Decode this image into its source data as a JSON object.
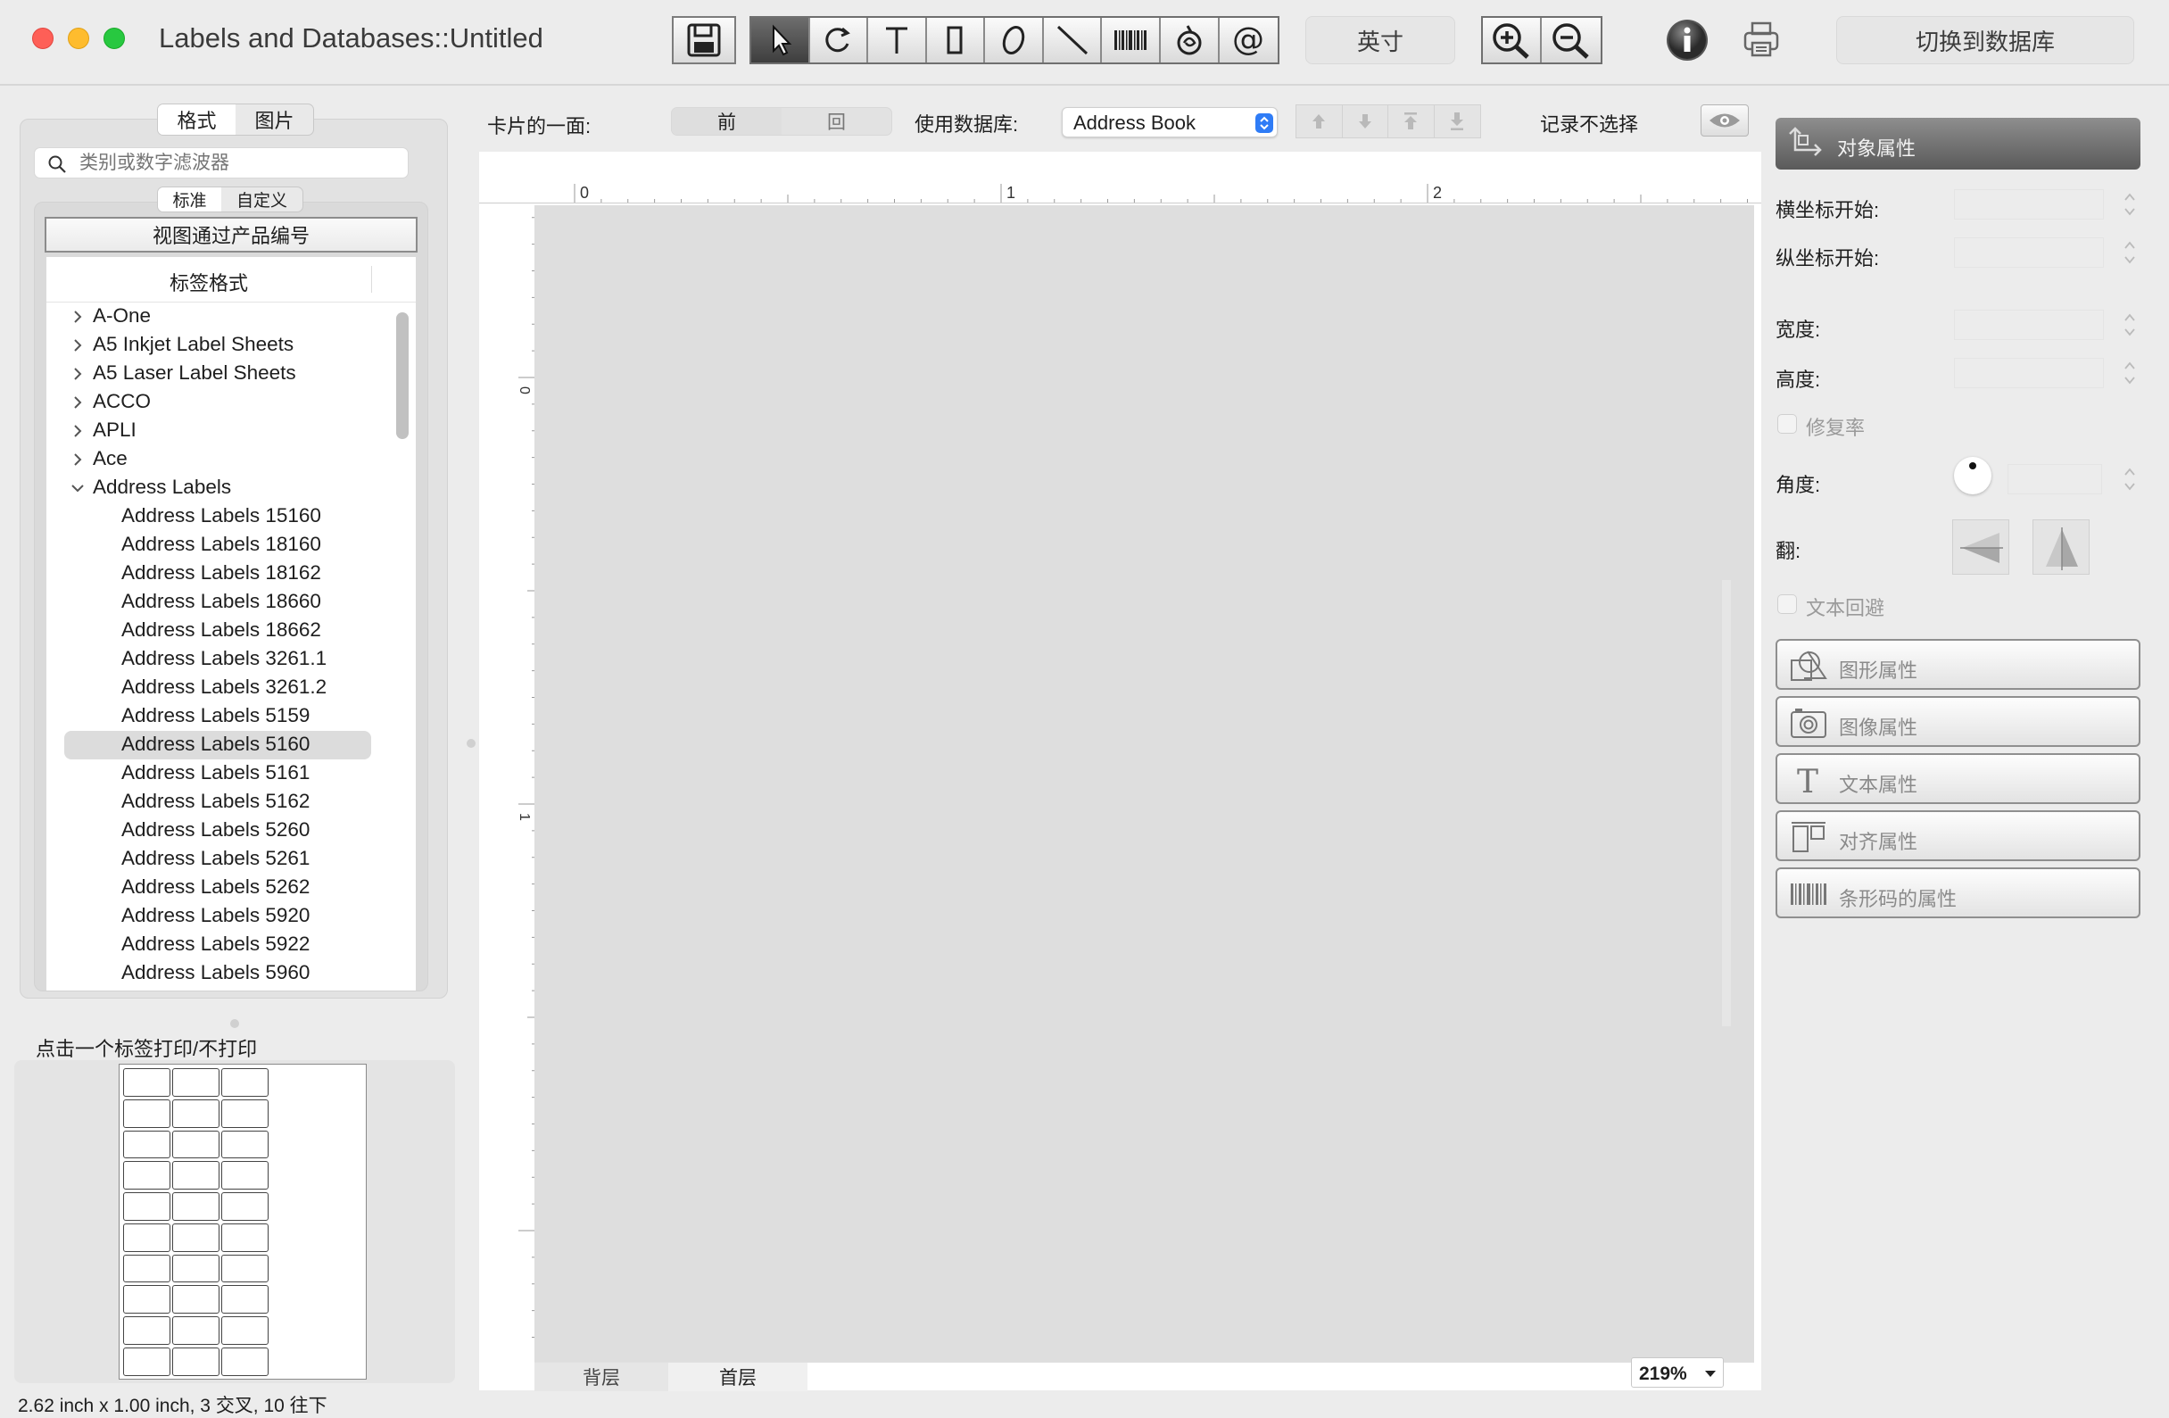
{
  "window": {
    "title": "Labels and  Databases::Untitled"
  },
  "toolbar": {
    "tools": [
      "save-icon",
      "pointer-icon",
      "rotate-icon",
      "text-tool-icon",
      "rectangle-tool-icon",
      "ellipse-tool-icon",
      "line-tool-icon",
      "barcode-tool-icon",
      "image-tool-icon",
      "at-field-icon"
    ],
    "units_label": "英寸",
    "zoom_in_icon": "zoom-in-icon",
    "zoom_out_icon": "zoom-out-icon",
    "info_icon": "info-icon",
    "print_icon": "print-icon",
    "switch_db_label": "切换到数据库"
  },
  "left": {
    "tabs": [
      "格式",
      "图片"
    ],
    "search_placeholder": "类别或数字滤波器",
    "subtabs": [
      "标准",
      "自定义"
    ],
    "view_by_product_label": "视图通过产品编号",
    "column_header": "标签格式",
    "tree": [
      {
        "label": "A-One",
        "level": 0,
        "expanded": false
      },
      {
        "label": "A5 Inkjet Label Sheets",
        "level": 0,
        "expanded": false
      },
      {
        "label": "A5 Laser Label Sheets",
        "level": 0,
        "expanded": false
      },
      {
        "label": "ACCO",
        "level": 0,
        "expanded": false
      },
      {
        "label": "APLI",
        "level": 0,
        "expanded": false
      },
      {
        "label": "Ace",
        "level": 0,
        "expanded": false
      },
      {
        "label": "Address Labels",
        "level": 0,
        "expanded": true
      },
      {
        "label": "Address Labels 15160",
        "level": 1
      },
      {
        "label": "Address Labels 18160",
        "level": 1
      },
      {
        "label": "Address Labels 18162",
        "level": 1
      },
      {
        "label": "Address Labels 18660",
        "level": 1
      },
      {
        "label": "Address Labels 18662",
        "level": 1
      },
      {
        "label": "Address Labels 3261.1",
        "level": 1
      },
      {
        "label": "Address Labels 3261.2",
        "level": 1
      },
      {
        "label": "Address Labels 5159",
        "level": 1
      },
      {
        "label": "Address Labels 5160",
        "level": 1,
        "selected": true
      },
      {
        "label": "Address Labels 5161",
        "level": 1
      },
      {
        "label": "Address Labels 5162",
        "level": 1
      },
      {
        "label": "Address Labels 5260",
        "level": 1
      },
      {
        "label": "Address Labels 5261",
        "level": 1
      },
      {
        "label": "Address Labels 5262",
        "level": 1
      },
      {
        "label": "Address Labels 5920",
        "level": 1
      },
      {
        "label": "Address Labels 5922",
        "level": 1
      },
      {
        "label": "Address Labels 5960",
        "level": 1
      }
    ],
    "preview_caption": "点击一个标签打印/不打印",
    "sheet_columns": 3,
    "sheet_rows": 10,
    "status_line": "2.62 inch x 1.00 inch, 3 交叉, 10 往下"
  },
  "center": {
    "card_side_label": "卡片的一面:",
    "side_tabs": [
      "前",
      "回"
    ],
    "use_db_label": "使用数据库:",
    "db_selected": "Address Book",
    "nav_icons": [
      "arrow-up-icon",
      "arrow-down-icon",
      "arrow-first-icon",
      "arrow-last-icon"
    ],
    "record_label": "记录不选择",
    "eye_icon": "eye-icon",
    "ruler_h_ticks": [
      "0",
      "1",
      "2"
    ],
    "ruler_v_ticks": [
      "0",
      "1"
    ],
    "layer_tabs": [
      "背层",
      "首层"
    ],
    "zoom_value": "219%"
  },
  "right": {
    "object_props_label": "对象属性",
    "x_start_label": "横坐标开始:",
    "y_start_label": "纵坐标开始:",
    "width_label": "宽度:",
    "height_label": "高度:",
    "lock_ratio_label": "修复率",
    "angle_label": "角度:",
    "flip_label": "翻:",
    "text_wrap_label": "文本回避",
    "buttons": [
      {
        "label": "图形属性",
        "icon": "shapes-icon"
      },
      {
        "label": "图像属性",
        "icon": "camera-icon"
      },
      {
        "label": "文本属性",
        "icon": "text-icon"
      },
      {
        "label": "对齐属性",
        "icon": "align-icon"
      },
      {
        "label": "条形码的属性",
        "icon": "barcode-icon"
      }
    ]
  },
  "colors": {
    "close": "#fe5f57",
    "minimize": "#febc2e",
    "zoom": "#28c840",
    "canvas": "#dedede",
    "selection": "#dcdcdc",
    "accent_blue": "#2f7cf6"
  }
}
